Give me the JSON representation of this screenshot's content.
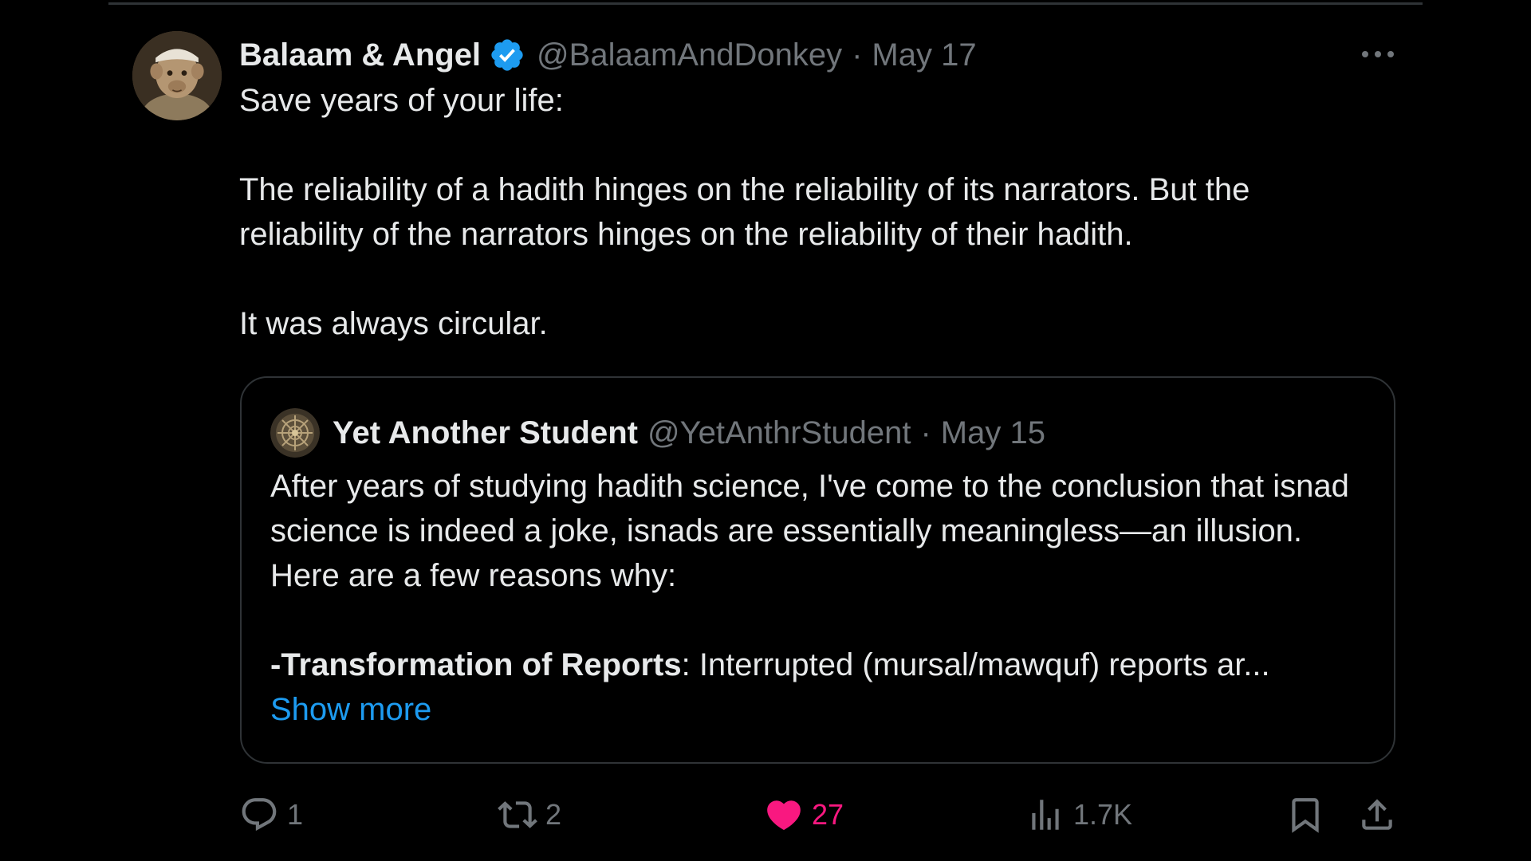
{
  "tweet": {
    "author_name": "Balaam & Angel",
    "handle": "@BalaamAndDonkey",
    "separator": "·",
    "date": "May 17",
    "text_lines": [
      "Save years of your life:",
      "The reliability of a hadith hinges on the reliability of its narrators. But the reliability of the narrators hinges on the reliability of their hadith.",
      "It was always circular."
    ]
  },
  "quote": {
    "author_name": "Yet Another Student",
    "handle": "@YetAnthrStudent",
    "separator": "·",
    "date": "May 15",
    "paragraph1": "After years of studying hadith science, I've come to the conclusion that isnad science is indeed a joke, isnads are essentially meaningless—an illusion. Here are a few reasons why:",
    "paragraph2_bold": "-Transformation of Reports",
    "paragraph2_rest": ": Interrupted (mursal/mawquf) reports ar...",
    "show_more": "Show more"
  },
  "actions": {
    "replies": "1",
    "retweets": "2",
    "likes": "27",
    "views": "1.7K"
  },
  "colors": {
    "background": "#000000",
    "text": "#e7e9ea",
    "muted": "#71767b",
    "link": "#1d9bf0",
    "like": "#f91880",
    "verified": "#1d9bf0",
    "border": "#2f3336"
  }
}
